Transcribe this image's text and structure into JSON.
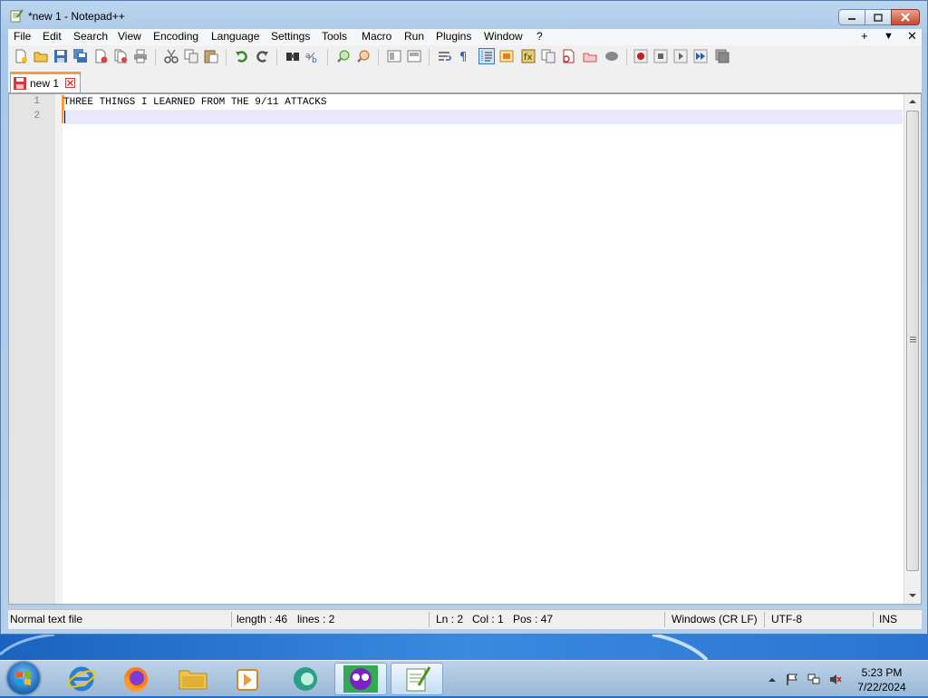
{
  "window": {
    "title": "*new 1 - Notepad++"
  },
  "menu": {
    "items": [
      "File",
      "Edit",
      "Search",
      "View",
      "Encoding",
      "Language",
      "Settings",
      "Tools",
      "Macro",
      "Run",
      "Plugins",
      "Window",
      "?"
    ],
    "right": [
      "+",
      "▼",
      "✕"
    ]
  },
  "tabs": [
    {
      "label": "new 1",
      "modified": true
    }
  ],
  "editor": {
    "line_numbers": [
      "1",
      "2"
    ],
    "lines": [
      "THREE THINGS I LEARNED FROM THE 9/11 ATTACKS",
      ""
    ]
  },
  "status": {
    "file_type": "Normal text file",
    "length": "length : 46",
    "lines": "lines : 2",
    "ln": "Ln : 2",
    "col": "Col : 1",
    "pos": "Pos : 47",
    "eol": "Windows (CR LF)",
    "encoding": "UTF-8",
    "mode": "INS"
  },
  "taskbar": {
    "time": "5:23 PM",
    "date": "7/22/2024",
    "apps": [
      "internet-explorer",
      "firefox",
      "file-explorer",
      "media-player",
      "app-green",
      "app-purple",
      "notepad-plus-plus"
    ]
  },
  "colors": {
    "tab_accent": "#fa9a3a",
    "current_line": "#e8e8ff",
    "gutter": "#e4e4e4"
  }
}
